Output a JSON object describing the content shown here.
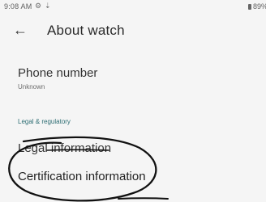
{
  "status_bar": {
    "time": "9:08 AM",
    "battery": "89%",
    "icons": [
      "gear-icon",
      "notification-icon",
      "battery-icon"
    ]
  },
  "header": {
    "title": "About watch",
    "back_icon": "arrow-left-icon"
  },
  "phone_number": {
    "title": "Phone number",
    "value": "Unknown"
  },
  "legal_section": {
    "header": "Legal & regulatory",
    "items": [
      {
        "label": "Legal information"
      },
      {
        "label": "Certification information"
      }
    ]
  },
  "annotation": {
    "type": "hand-drawn-oval-highlight",
    "color": "#111111"
  }
}
